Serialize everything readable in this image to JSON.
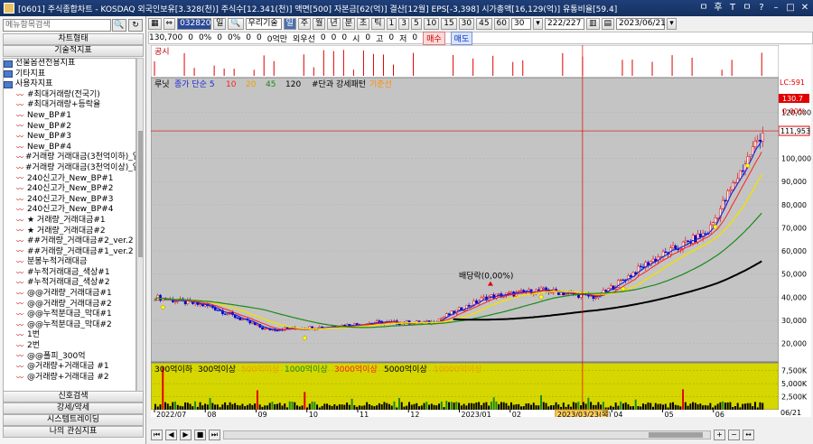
{
  "window": {
    "title": "[0601] 주식종합차트 - KOSDAQ 외국인보유[3.328(천)] 주식수[12.341(천)] 액면[500] 자본금[62(억)] 결산[12월] EPS[-3,398] 시가총액[16,129(억)] 유통비율[59.4]",
    "buttons": [
      "ㅁ",
      "후",
      "T",
      "ㅁ",
      "?",
      "–",
      "□",
      "✕"
    ]
  },
  "left_panel": {
    "search_placeholder": "메뉴항목검색",
    "section_chart_type": "차트형태",
    "section_technical": "기술적지표",
    "folders": [
      "선물옵션전용지표",
      "기타지표",
      "사용자지표"
    ],
    "items": [
      "#최대거래량(전국기)",
      "#최대거래량+등락율",
      "New_BP#1",
      "New_BP#2",
      "New_BP#3",
      "New_BP#4",
      "#거래량 거래대금(3천억이하)_일봉",
      "#거래량 거래대금(3천억이상)_일봉",
      "240신고가_New_BP#1",
      "240신고가_New_BP#2",
      "240신고가_New_BP#3",
      "240신고가_New_BP#4",
      "★ 거래량_거래대금#1",
      "★ 거래량_거래대금#2",
      "##거래량_거래대금#2_ver.2",
      "##거래량_거래대금#1_ver.2",
      "분봉누적거래대금",
      "#누적거래대금_색상#1",
      "#누적거래대금_색상#2",
      "@@거래량_거래대금#1",
      "@@거래량_거래대금#2",
      "@@누적분대금_막대#1",
      "@@누적분대금_막대#2",
      "1번",
      "2번",
      "@@폴피_300억",
      "@거래량+거래대금 #1",
      "@거래량+거래대금 #2"
    ],
    "bottom_buttons": [
      "신호검색",
      "강세/약세",
      "시스템트레이딩",
      "나의 관심지표"
    ]
  },
  "toolbar1": {
    "code": "032820",
    "type_label": "일",
    "name": "우리기술",
    "period_buttons": [
      "일",
      "주",
      "월",
      "년",
      "분",
      "초",
      "틱"
    ],
    "interval_buttons": [
      "1",
      "3",
      "5",
      "10",
      "15",
      "30",
      "45",
      "60"
    ],
    "count_value": "30",
    "page_value": "222/227",
    "date_value": "2023/06/21"
  },
  "toolbar2": {
    "fields": [
      "130,700",
      "0",
      "0%",
      "0",
      "0%",
      "0",
      "0",
      "0억만",
      "외우선",
      "0",
      "0",
      "0",
      "시",
      "0",
      "고",
      "0",
      "저",
      "0"
    ],
    "buy_label": "매수",
    "sell_label": "매도"
  },
  "chart_data": {
    "type": "candlestick",
    "panels": {
      "disclosure": {
        "label": "공시"
      },
      "price": {
        "legend": [
          "루닛",
          "종가 단순 5",
          "10",
          "20",
          "45",
          "120",
          "#단과 강세패턴",
          "기준선"
        ],
        "legend_colors": [
          "#000000",
          "#1d28d8",
          "#ff2020",
          "#f0a000",
          "#1a8a1a",
          "#000000",
          "#000000",
          "#ff8c00"
        ],
        "yticks": [
          20000,
          30000,
          40000,
          50000,
          60000,
          70000,
          80000,
          90000,
          100000,
          110000,
          120000
        ],
        "ytick_labels": [
          "20,000",
          "30,000",
          "40,000",
          "50,000",
          "60,000",
          "70,000",
          "80,000",
          "90,000",
          "100,000",
          "",
          "120,000"
        ],
        "ylim": [
          12000,
          135000
        ],
        "current_price_label": "111,953",
        "right_labels": [
          "LC:591",
          "130.7",
          "0.00%"
        ],
        "annotation": "배당락(0,00%)"
      },
      "volume": {
        "legend": [
          "300억이하",
          "300억이상",
          "500억이상",
          "1000억이상",
          "3000억이상",
          "5000억이상",
          "10000억이상"
        ],
        "legend_colors": [
          "#000000",
          "#000000",
          "#f0a000",
          "#1a8a1a",
          "#ff2020",
          "#000000",
          "#f0a000"
        ],
        "yticks": [
          2500,
          5000,
          7500
        ],
        "ytick_labels": [
          "2,500K",
          "5,000K",
          "7,500K"
        ]
      }
    },
    "x_labels": [
      "2022/07",
      "08",
      "09",
      "10",
      "11",
      "12",
      "2023/01",
      "02",
      "03",
      "04",
      "05",
      "06"
    ],
    "crosshair_date": "2023/03/23(목)",
    "right_date": "06/21",
    "monthly_closes": [
      40000,
      36000,
      26000,
      27000,
      29000,
      29000,
      40000,
      43000,
      40000,
      56000,
      68000,
      112000
    ]
  }
}
